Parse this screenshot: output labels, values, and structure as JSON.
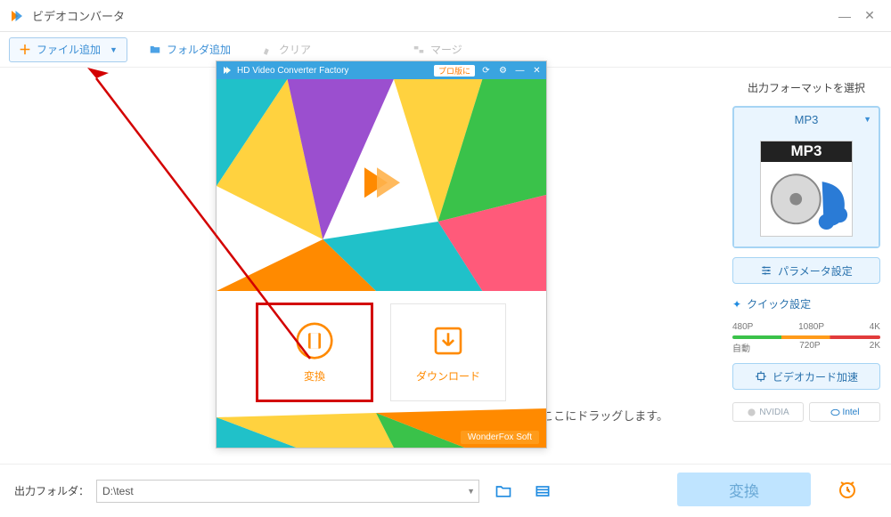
{
  "window": {
    "title": "ビデオコンバータ"
  },
  "toolbar": {
    "add_file": "ファイル追加",
    "add_folder": "フォルダ追加",
    "clear": "クリア",
    "merge": "マージ"
  },
  "main_hint": "「+」をクリックしてファイルを追加、または直接ファイルをここにドラッグします。",
  "splash": {
    "title": "HD Video Converter Factory",
    "pro_badge": "プロ版に",
    "convert": "変換",
    "download": "ダウンロード",
    "brand": "WonderFox Soft"
  },
  "right": {
    "choose_format": "出力フォーマットを選択",
    "format": "MP3",
    "format_tile": "MP3",
    "param_settings": "パラメータ設定",
    "quick_settings": "クイック設定",
    "presets_top": [
      "480P",
      "1080P",
      "4K"
    ],
    "presets_bot": [
      "自動",
      "720P",
      "2K"
    ],
    "gpu_accel": "ビデオカード加速",
    "nvidia": "NVIDIA",
    "intel": "Intel"
  },
  "bottom": {
    "out_folder_label": "出力フォルダ：",
    "out_folder_value": "D:\\test",
    "convert": "変換"
  }
}
